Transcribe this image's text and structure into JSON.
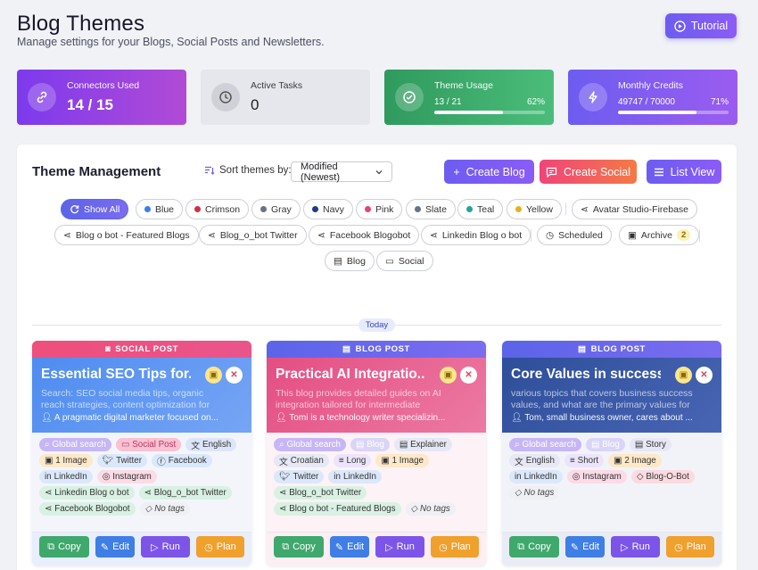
{
  "header": {
    "title": "Blog Themes",
    "subtitle": "Manage settings for your Blogs, Social Posts and Newsletters.",
    "tutorial_label": "Tutorial"
  },
  "stats": [
    {
      "label": "Connectors Used",
      "value": "14 / 15"
    },
    {
      "label": "Active Tasks",
      "value": "0"
    },
    {
      "label": "Theme Usage",
      "value": "13 / 21",
      "percent": "62%",
      "progress": 0.62
    },
    {
      "label": "Monthly Credits",
      "value": "49747 / 70000",
      "percent": "71%",
      "progress": 0.71
    }
  ],
  "panel": {
    "title": "Theme Management",
    "sort_label": "Sort themes by:",
    "sort_value": "Modified (Newest)",
    "create_blog": "Create Blog",
    "create_social": "Create Social",
    "list_view": "List View"
  },
  "filters": {
    "show_all": "Show All",
    "colors": [
      {
        "label": "Blue",
        "color": "#3b7ded"
      },
      {
        "label": "Crimson",
        "color": "#d1303f"
      },
      {
        "label": "Gray",
        "color": "#6b7280"
      },
      {
        "label": "Navy",
        "color": "#1e3a8a"
      },
      {
        "label": "Pink",
        "color": "#e0457b"
      },
      {
        "label": "Slate",
        "color": "#64748b"
      },
      {
        "label": "Teal",
        "color": "#2aa198"
      },
      {
        "label": "Yellow",
        "color": "#e3b121"
      }
    ],
    "connectors": [
      "Avatar Studio-Firebase",
      "Blog o bot - Featured Blogs",
      "Blog_o_bot Twitter",
      "Facebook Blogobot",
      "Linkedin Blog o bot"
    ],
    "scheduled": "Scheduled",
    "archive": "Archive",
    "archive_count": "2",
    "blog": "Blog",
    "social": "Social"
  },
  "divider_label": "Today",
  "cards": [
    {
      "type_label": "SOCIAL POST",
      "title": "Essential SEO Tips for...",
      "description": "Search: SEO social media tips, organic reach strategies, content optimization for social...",
      "author": "A pragmatic digital marketer focused on...",
      "tags": [
        "Global search",
        "Social Post",
        "English",
        "1 Image",
        "Twitter",
        "Facebook",
        "LinkedIn",
        "Instagram",
        "Linkedin Blog o bot",
        "Blog_o_bot Twitter",
        "Facebook Blogobot",
        "No tags"
      ]
    },
    {
      "type_label": "BLOG POST",
      "title": "Practical AI Integratio...",
      "description": "This blog provides detailed guides on AI integration tailored for intermediate professiona...",
      "author": "Tomi is a technology writer specializin...",
      "tags": [
        "Global search",
        "Blog",
        "Explainer",
        "Croatian",
        "Long",
        "1 Image",
        "Twitter",
        "LinkedIn",
        "Blog_o_bot Twitter",
        "Blog o bot - Featured Blogs",
        "No tags"
      ]
    },
    {
      "type_label": "BLOG POST",
      "title": "Core Values in success",
      "description": "various topics that covers business success values, and what are the primary values for the...",
      "author": "Tom, small business owner, cares about ...",
      "tags": [
        "Global search",
        "Blog",
        "Story",
        "English",
        "Short",
        "2 Image",
        "LinkedIn",
        "Instagram",
        "Blog-O-Bot",
        "No tags"
      ]
    }
  ],
  "card_actions": {
    "copy": "Copy",
    "edit": "Edit",
    "run": "Run",
    "plan": "Plan"
  }
}
